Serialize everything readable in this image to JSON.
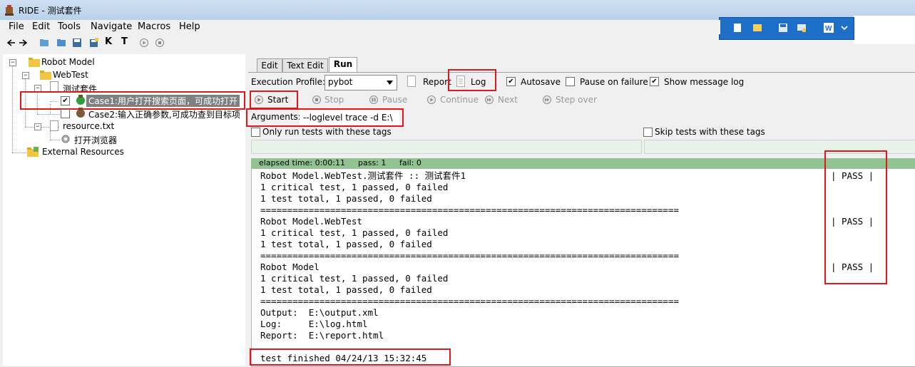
{
  "window": {
    "title": "RIDE - 测试套件"
  },
  "menu": [
    {
      "label": "File"
    },
    {
      "label": "Edit"
    },
    {
      "label": "Tools"
    },
    {
      "label": "Navigate"
    },
    {
      "label": "Macros"
    },
    {
      "label": "Help"
    }
  ],
  "toolbar_letters": {
    "k": "K",
    "t": "T"
  },
  "tree": {
    "robot_model": "Robot Model",
    "webtest": "WebTest",
    "suite": "测试套件",
    "case1": "Case1:用户打开搜索页面，可成功打开",
    "case2": "Case2:输入正确参数,可成功查到目标项",
    "resource": "resource.txt",
    "keyword": "打开浏览器",
    "external": "External Resources"
  },
  "tabs": [
    {
      "label": "Edit"
    },
    {
      "label": "Text Edit"
    },
    {
      "label": "Run"
    }
  ],
  "run": {
    "execution_profile_label": "Execution Profile:",
    "profile_value": "pybot",
    "report_label": "Report",
    "log_label": "Log",
    "autosave_label": "Autosave",
    "pause_label": "Pause on failure",
    "show_msg_label": "Show message log",
    "start": "Start",
    "stop": "Stop",
    "pause": "Pause",
    "continue": "Continue",
    "next": "Next",
    "step_over": "Step over",
    "arguments_label": "Arguments:",
    "arguments_value": "--loglevel trace -d E:\\",
    "only_run_label": "Only run tests with these tags",
    "skip_label": "Skip tests with these tags",
    "elapsed": "elapsed time: 0:00:11",
    "pass": "pass: 1",
    "fail": "fail: 0"
  },
  "output": {
    "l1": "Robot Model.WebTest.测试套件 :: 测试套件1",
    "l2": "1 critical test, 1 passed, 0 failed",
    "l3": "1 test total, 1 passed, 0 failed",
    "sep": "==============================================================================",
    "l4": "Robot Model.WebTest",
    "l5": "1 critical test, 1 passed, 0 failed",
    "l6": "1 test total, 1 passed, 0 failed",
    "l7": "Robot Model",
    "l8": "1 critical test, 1 passed, 0 failed",
    "l9": "1 test total, 1 passed, 0 failed",
    "pass_tag": "| PASS |",
    "out_output": "Output:  E:\\output.xml",
    "out_log": "Log:     E:\\log.html",
    "out_report": "Report:  E:\\report.html",
    "finished": "test finished 04/24/13 15:32:45"
  },
  "colors": {
    "accent_red": "#e0181b",
    "status_bar": "#90c390",
    "float_toolbar": "#1e6fc8"
  }
}
